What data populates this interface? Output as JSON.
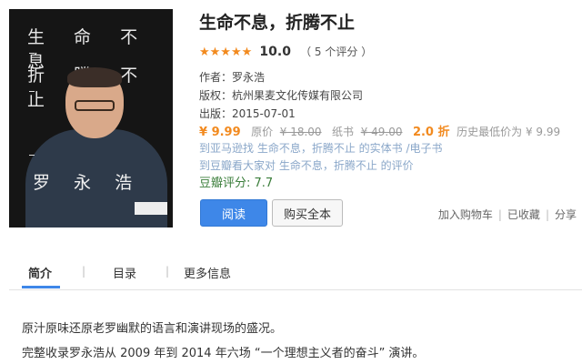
{
  "book": {
    "cover": {
      "title_line1": "生 命 不 息",
      "title_line2": "折 腾 不 止",
      "author": "罗 永 浩"
    },
    "title": "生命不息，折腾不止",
    "rating": {
      "stars": "★★★★★",
      "score": "10.0",
      "count": "（ 5 个评分 ）"
    },
    "author_line": "作者：罗永浩",
    "copyright_line": "版权：杭州果麦文化传媒有限公司",
    "publish_line": "出版：2015-07-01",
    "price": "¥ 9.99",
    "original_label": "原价",
    "original_price": "¥ 18.00",
    "paper_label": "纸书",
    "paper_price": "¥ 49.00",
    "discount": "2.0 折",
    "lowest_label": "历史最低价为 ¥ 9.99",
    "amazon_link": "到亚马逊找 生命不息，折腾不止 的实体书 /电子书",
    "douban_link": "到豆瓣看大家对 生命不息，折腾不止 的评价",
    "douban_score": "豆瓣评分: 7.7"
  },
  "buttons": {
    "read": "阅读",
    "buy": "购买全本"
  },
  "actions": {
    "cart": "加入购物车",
    "collected": "已收藏",
    "share": "分享",
    "separator": "|"
  },
  "tabs": {
    "intro": "简介",
    "toc": "目录",
    "more": "更多信息",
    "separator": "|"
  },
  "intro": {
    "line1": "原汁原味还原老罗幽默的语言和演讲现场的盛况。",
    "line2": "完整收录罗永浩从 2009 年到 2014 年六场 “一个理想主义者的奋斗” 演讲。"
  }
}
